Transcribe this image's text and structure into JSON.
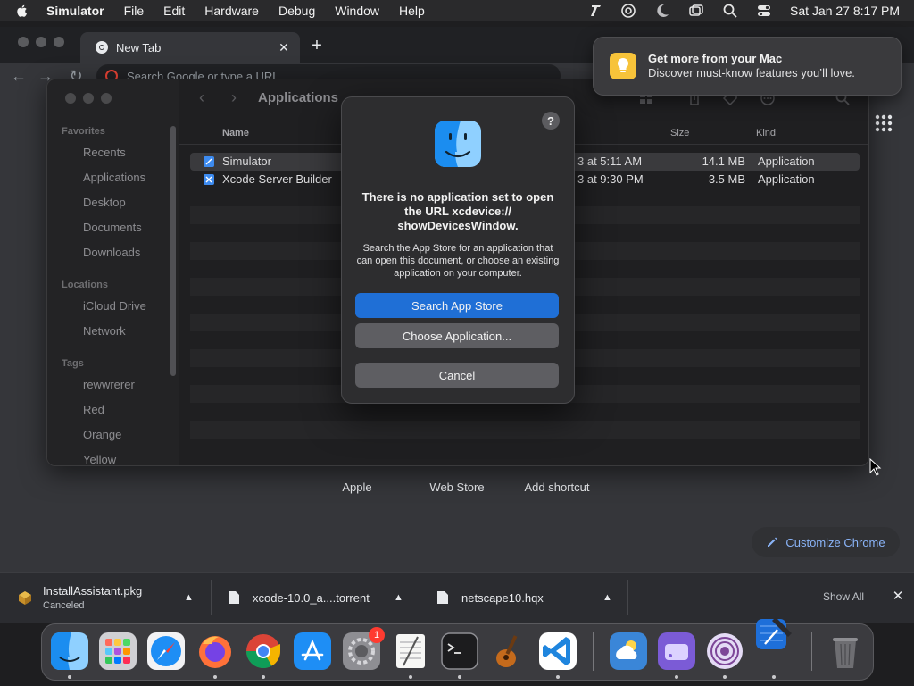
{
  "menubar": {
    "app_name": "Simulator",
    "menus": [
      "File",
      "Edit",
      "Hardware",
      "Debug",
      "Window",
      "Help"
    ],
    "datetime": "Sat Jan 27  8:17 PM",
    "status_icons": [
      "typeface-icon",
      "creative-cloud-icon",
      "moon-icon",
      "screens-icon",
      "search-icon",
      "control-center-icon"
    ]
  },
  "chrome": {
    "tab_label": "New Tab",
    "omnibox_placeholder": "Search Google or type a URL",
    "shortcuts": [
      "Apple",
      "Web Store",
      "Add shortcut"
    ],
    "customize_label": "Customize Chrome",
    "downloads": [
      {
        "name": "InstallAssistant.pkg",
        "status": "Canceled"
      },
      {
        "name": "xcode-10.0_a....torrent",
        "status": ""
      },
      {
        "name": "netscape10.hqx",
        "status": ""
      }
    ],
    "show_all": "Show All"
  },
  "finder": {
    "title": "Applications",
    "sidebar": {
      "favorites_label": "Favorites",
      "favorites": [
        "Recents",
        "Applications",
        "Desktop",
        "Documents",
        "Downloads"
      ],
      "locations_label": "Locations",
      "locations": [
        "iCloud Drive",
        "Network"
      ],
      "tags_label": "Tags",
      "tags": [
        "rewwrerer",
        "Red",
        "Orange",
        "Yellow"
      ]
    },
    "columns": {
      "name": "Name",
      "size": "Size",
      "kind": "Kind"
    },
    "rows": [
      {
        "name": "Simulator",
        "date": "3 at 5:11 AM",
        "size": "14.1 MB",
        "kind": "Application"
      },
      {
        "name": "Xcode Server Builder",
        "date": "3 at 9:30 PM",
        "size": "3.5 MB",
        "kind": "Application"
      }
    ]
  },
  "dialog": {
    "help": "?",
    "title": "There is no application set to open the URL xcdevice:// showDevicesWindow.",
    "message": "Search the App Store for an application that can open this document, or choose an existing application on your computer.",
    "search_label": "Search App Store",
    "choose_label": "Choose Application...",
    "cancel_label": "Cancel"
  },
  "notification": {
    "title": "Get more from your Mac",
    "body": "Discover must-know features you’ll love."
  },
  "dock": {
    "badge": "1",
    "apps": [
      "finder-icon",
      "launchpad-icon",
      "safari-icon",
      "firefox-icon",
      "chrome-icon",
      "app-store-icon",
      "system-preferences-icon",
      "textedit-icon",
      "terminal-icon",
      "garageband-icon",
      "vscode-icon",
      "weather-icon",
      "disk-utility-icon",
      "tor-browser-icon",
      "xcode-icon",
      "trash-icon"
    ]
  },
  "colors": {
    "accent_blue": "#1f6fd6",
    "chrome_link": "#8ab4f8",
    "badge_red": "#ff3b30"
  }
}
